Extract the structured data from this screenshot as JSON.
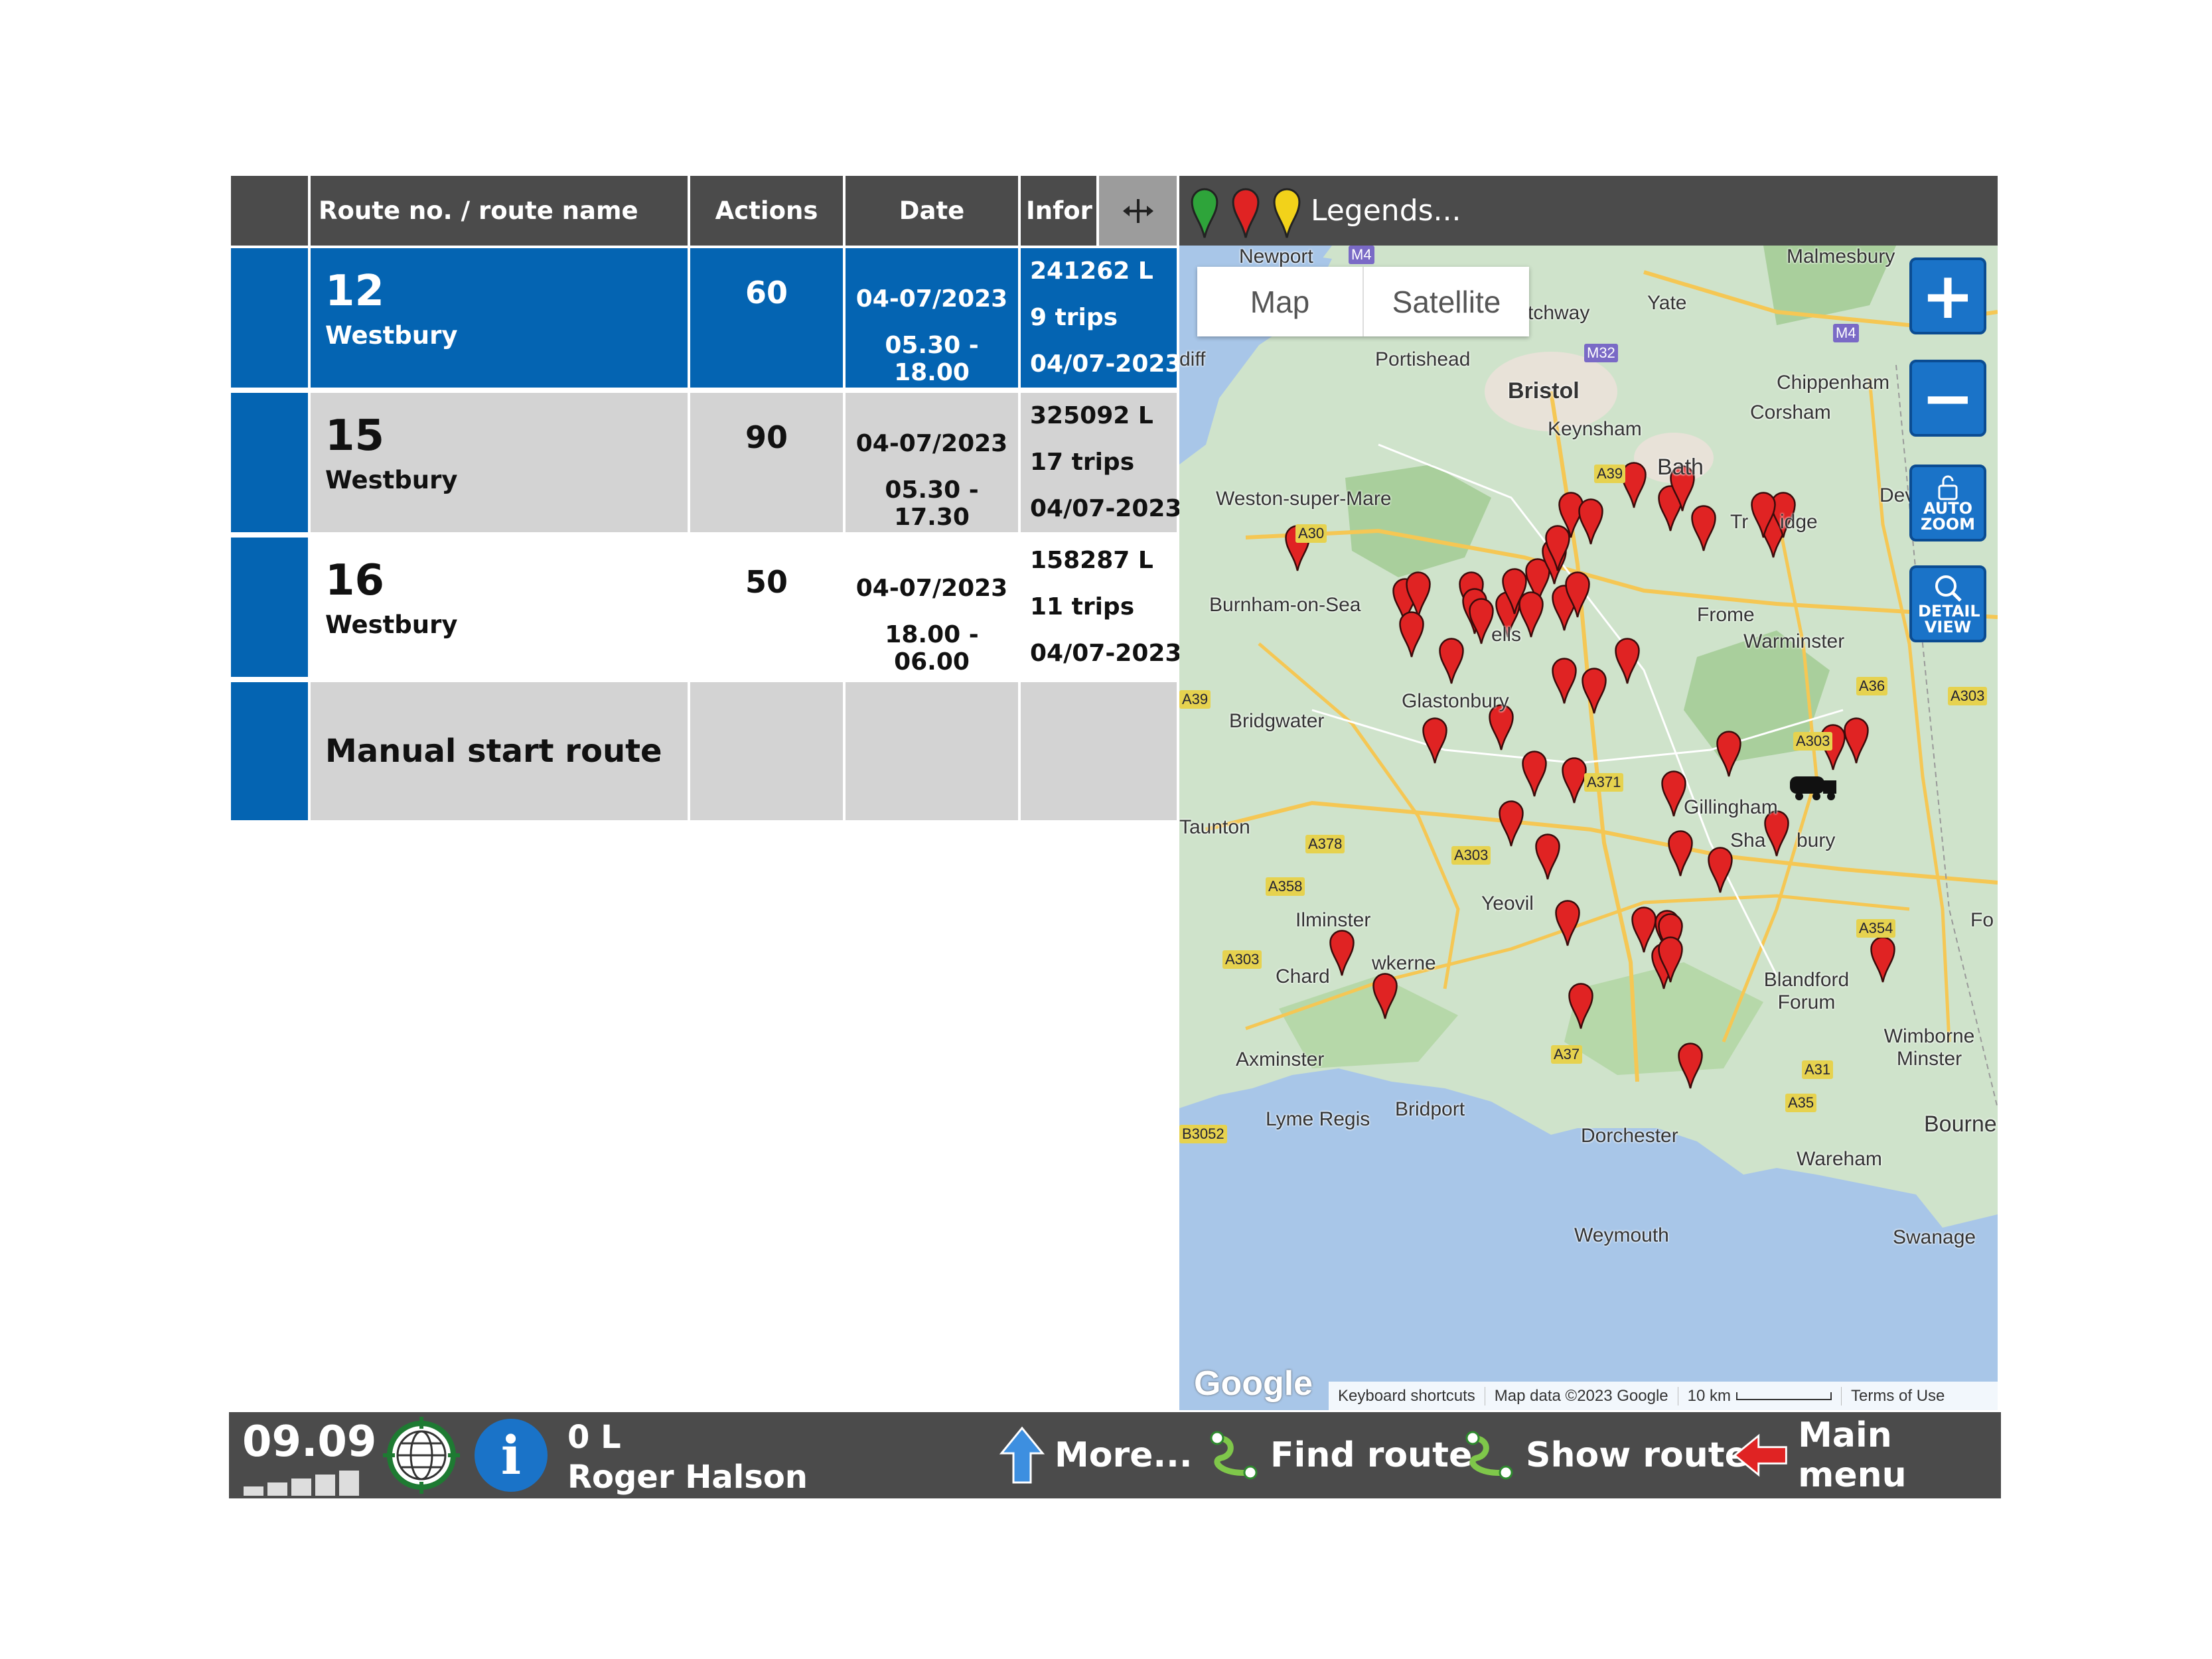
{
  "table": {
    "headers": {
      "route": "Route no. / route name",
      "actions": "Actions",
      "date": "Date",
      "info": "Infor",
      "move_icon": "move-arrows-icon"
    },
    "rows": [
      {
        "number": "12",
        "name": "Westbury",
        "actions": "60",
        "date": "04-07/2023",
        "time": "05.30 - 18.00",
        "volume": "241262 L",
        "trips": "9 trips",
        "info_date": "04/07-2023",
        "selected": true
      },
      {
        "number": "15",
        "name": "Westbury",
        "actions": "90",
        "date": "04-07/2023",
        "time": "05.30 - 17.30",
        "volume": "325092 L",
        "trips": "17 trips",
        "info_date": "04/07-2023",
        "selected": false
      },
      {
        "number": "16",
        "name": "Westbury",
        "actions": "50",
        "date": "04-07/2023",
        "time": "18.00 - 06.00",
        "volume": "158287 L",
        "trips": "11 trips",
        "info_date": "04/07-2023",
        "selected": false
      }
    ],
    "manual_start": "Manual start route"
  },
  "map": {
    "legends_label": "Legends...",
    "legend_pin_colors": [
      "#2ea43a",
      "#e02323",
      "#f2d21a"
    ],
    "toggle": {
      "map": "Map",
      "satellite": "Satellite"
    },
    "buttons": {
      "zoom_in": "+",
      "zoom_out": "−",
      "auto_zoom": "AUTO ZOOM",
      "detail_view": "DETAIL VIEW"
    },
    "attribution": {
      "logo": "Google",
      "shortcuts": "Keyboard shortcuts",
      "map_data": "Map data ©2023 Google",
      "scale": "10 km",
      "terms": "Terms of Use"
    },
    "places": [
      "Newport",
      "Malmesbury",
      "Yate",
      "tchway",
      "Portishead",
      "Bristol",
      "Chippenham",
      "Corsham",
      "Keynsham",
      "Bath",
      "Weston-super-Mare",
      "Dev",
      "Burnham-on-Sea",
      "Frome",
      "Warminster",
      "Glastonbury",
      "Bridgwater",
      "Gillingham",
      "Taunton",
      "Sha",
      "bury",
      "Yeovil",
      "Ilminster",
      "Chard",
      "wkerne",
      "Blandford Forum",
      "Wimborne Minster",
      "Axminster",
      "Lyme Regis",
      "Bridport",
      "Dorchester",
      "Bourne",
      "Wareham",
      "Weymouth",
      "Swanage",
      "Fo",
      "diff",
      "ells",
      "Tr",
      "idge"
    ],
    "roads": [
      "M4",
      "M32",
      "M4",
      "A39",
      "A30",
      "A39",
      "A303",
      "A36",
      "A303",
      "A371",
      "A378",
      "A358",
      "A303",
      "A303",
      "A354",
      "A37",
      "A31",
      "A35",
      "B3052"
    ],
    "pin_color": "#e02323",
    "pins": 52
  },
  "footer": {
    "clock": "09.09",
    "volume": "0 L",
    "driver": "Roger Halson",
    "more": "More...",
    "find_route": "Find route",
    "show_route": "Show route",
    "main_menu": "Main menu"
  }
}
